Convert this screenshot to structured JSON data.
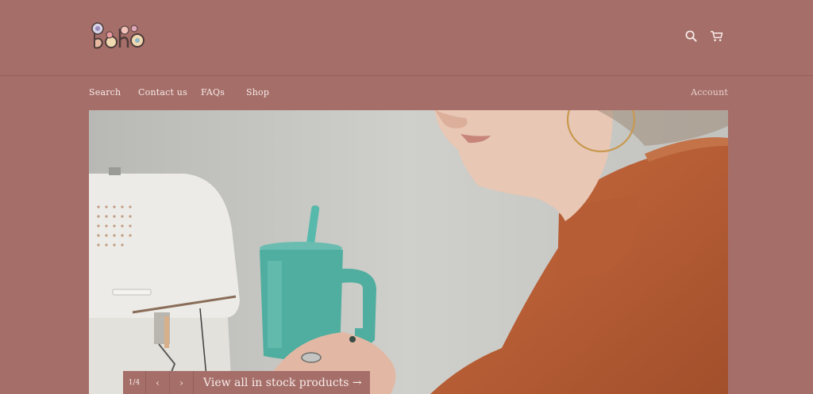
{
  "header": {
    "logo_text": "Boho",
    "icons": {
      "search": "search-icon",
      "cart": "cart-icon"
    }
  },
  "nav": {
    "items": [
      {
        "label": "Search"
      },
      {
        "label": "Contact us"
      },
      {
        "label": "FAQs"
      },
      {
        "label": "Shop"
      }
    ],
    "account_label": "Account"
  },
  "hero": {
    "alt": "Woman at a sewing machine with a teal tumbler",
    "slideshow": {
      "counter": "1/4",
      "prev_icon": "chevron-left-icon",
      "next_icon": "chevron-right-icon",
      "link_label": "View all in stock products →"
    }
  },
  "colors": {
    "background": "#a66e69",
    "text": "#f6ece9",
    "account_text": "#e8d2cd"
  }
}
